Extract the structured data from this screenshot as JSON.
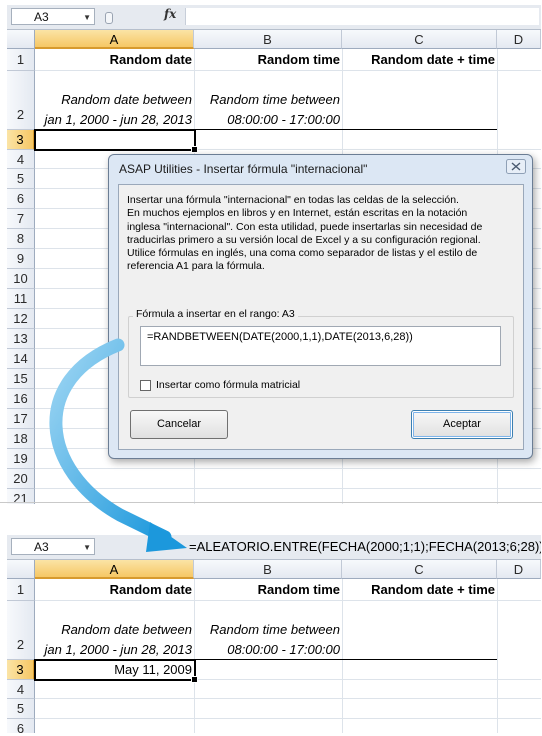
{
  "colors": {
    "accent_arrow": "#3aa7e0",
    "header_selected": "#f6c765",
    "dialog_bg": "#dce7f4"
  },
  "top_sheet": {
    "name_box": "A3",
    "fx_label": "fx",
    "formula_content": "",
    "columns": [
      "A",
      "B",
      "C",
      "D"
    ],
    "selected_column": "A",
    "rows": [
      "1",
      "2",
      "3",
      "4",
      "5",
      "6",
      "7",
      "8",
      "9",
      "10",
      "11",
      "12",
      "13",
      "14",
      "15",
      "16",
      "17",
      "18",
      "19",
      "20",
      "21"
    ],
    "selected_row": "3",
    "headers": {
      "a1": "Random date",
      "b1": "Random time",
      "c1": "Random date + time"
    },
    "row2": {
      "a_line1": "Random date between",
      "a_line2": "jan 1, 2000 - jun 28, 2013",
      "b_line1": "Random time between",
      "b_line2": "08:00:00 - 17:00:00"
    }
  },
  "dialog": {
    "title": "ASAP Utilities - Insertar fórmula \"internacional\"",
    "close_icon": "close-icon",
    "description": [
      "Insertar una fórmula \"internacional\" en todas las celdas de la selección.",
      "En muchos ejemplos en libros y en Internet, están escritas en la notación",
      "inglesa \"internacional\". Con esta utilidad, puede insertarlas sin necesidad de",
      "traducirlas primero a su versión local de Excel y a su configuración regional.",
      "Utilice fórmulas en inglés, una coma como separador de listas y el estilo de",
      "referencia A1 para la fórmula."
    ],
    "group_label": "Fórmula a insertar en el rango: A3",
    "formula_value": "=RANDBETWEEN(DATE(2000,1,1),DATE(2013,6,28))",
    "checkbox_label": "Insertar como fórmula matricial",
    "checkbox_checked": false,
    "cancel_label": "Cancelar",
    "accept_label": "Aceptar"
  },
  "bottom_sheet": {
    "name_box": "A3",
    "fx_label": "fx",
    "formula_content": "=ALEATORIO.ENTRE(FECHA(2000;1;1);FECHA(2013;6;28))",
    "columns": [
      "A",
      "B",
      "C",
      "D"
    ],
    "selected_column": "A",
    "rows": [
      "1",
      "2",
      "3",
      "4",
      "5",
      "6"
    ],
    "selected_row": "3",
    "headers": {
      "a1": "Random date",
      "b1": "Random time",
      "c1": "Random date + time"
    },
    "row2": {
      "a_line1": "Random date between",
      "a_line2": "jan 1, 2000 - jun 28, 2013",
      "b_line1": "Random time between",
      "b_line2": "08:00:00 - 17:00:00"
    },
    "a3_value": "May 11, 2009"
  }
}
